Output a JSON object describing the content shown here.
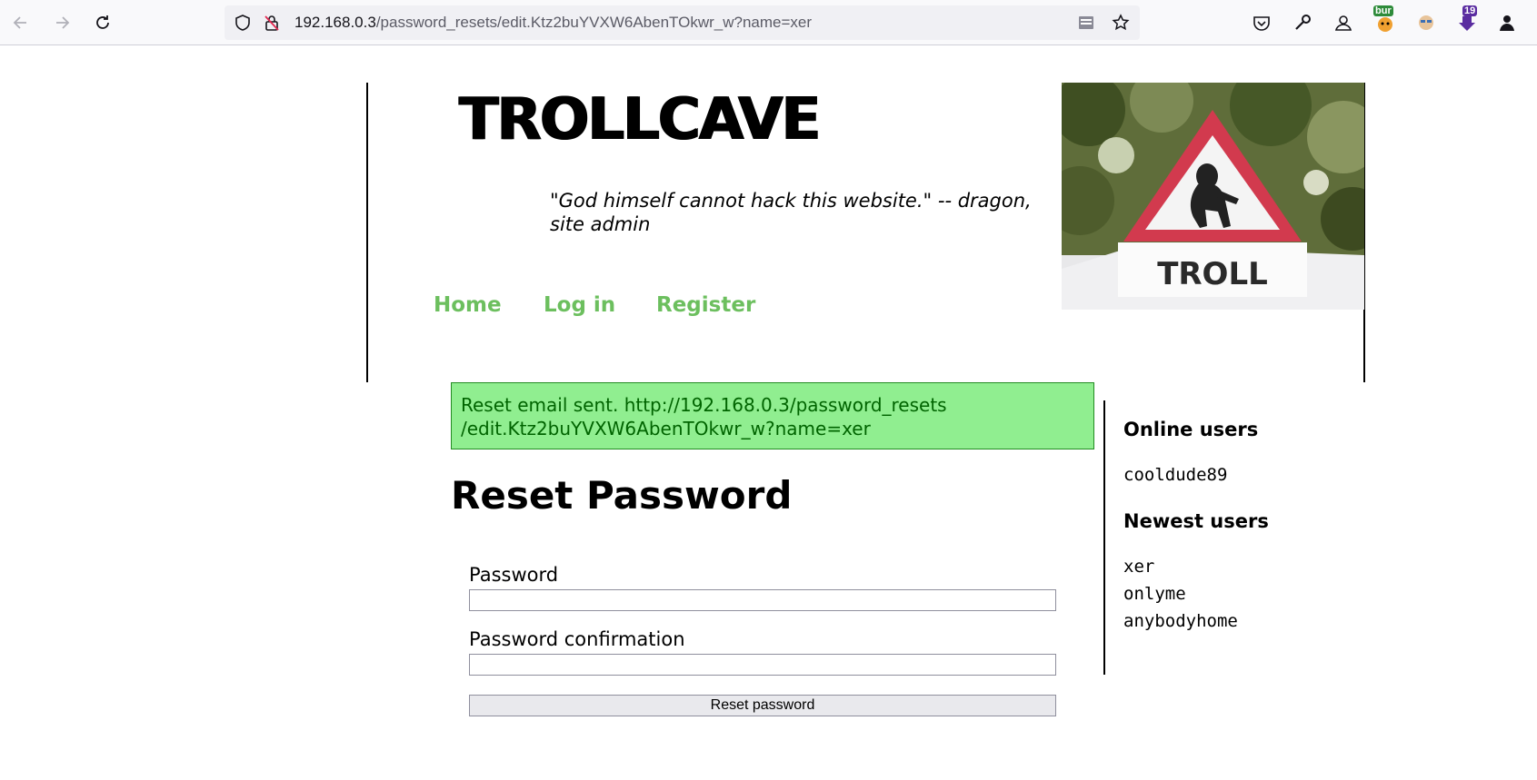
{
  "browser": {
    "url_host": "192.168.0.3",
    "url_path": "/password_resets/edit.Ktz2buYVXW6AbenTOkwr_w?name=xer",
    "icons": [
      "back-icon",
      "forward-icon",
      "reload-icon",
      "shield-icon",
      "insecure-lock-icon",
      "reader-view-icon",
      "bookmark-star-icon",
      "pocket-icon",
      "wrench-icon",
      "account-icon",
      "burp-extension-icon",
      "cookie-extension-icon",
      "download-extension-icon",
      "profile-icon"
    ],
    "ext_badges": {
      "burp": "bur",
      "downloads": "19"
    }
  },
  "site": {
    "title": "TROLLCAVE",
    "tagline": "\"God himself cannot hack this website.\" -- dragon, site admin",
    "image_caption": "TROLL",
    "nav": {
      "home": "Home",
      "login": "Log in",
      "register": "Register"
    },
    "nav_color": "#6cbf5e"
  },
  "flash": {
    "message": "Reset email sent. http://192.168.0.3/password_resets /edit.Ktz2buYVXW6AbenTOkwr_w?name=xer",
    "color": "#90ee90"
  },
  "form": {
    "heading": "Reset Password",
    "password_label": "Password",
    "password_value": "",
    "confirm_label": "Password confirmation",
    "confirm_value": "",
    "submit_label": "Reset password"
  },
  "sidebar": {
    "online_heading": "Online users",
    "online_users": [
      "cooldude89"
    ],
    "newest_heading": "Newest users",
    "newest_users": [
      "xer",
      "onlyme",
      "anybodyhome"
    ]
  }
}
